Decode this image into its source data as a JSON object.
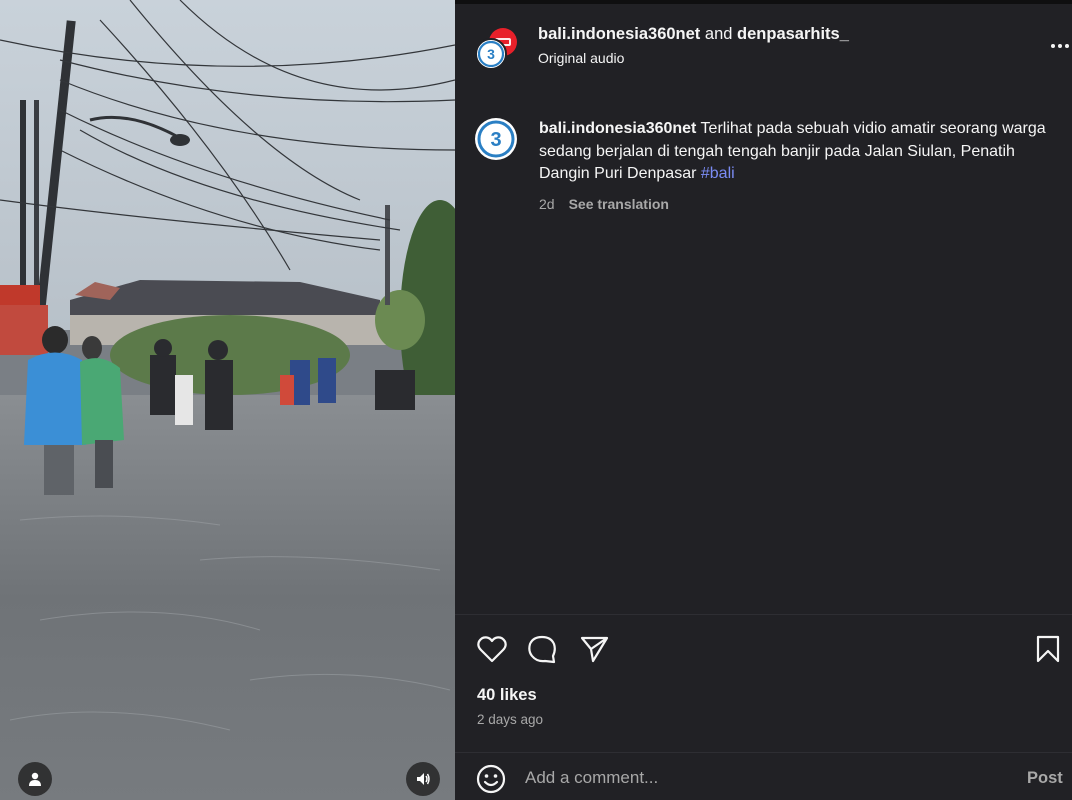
{
  "media": {
    "user_icon": "person-icon",
    "audio_icon": "speaker-icon"
  },
  "header": {
    "author": "bali.indonesia360net",
    "joiner": "and",
    "collaborator": "denpasarhits_",
    "audio_label": "Original audio",
    "avatar_glyph": "3°",
    "more_icon": "ellipsis-icon"
  },
  "caption": {
    "author": "bali.indonesia360net",
    "text": "Terlihat pada sebuah vidio amatir seorang warga sedang berjalan di tengah tengah banjir pada Jalan Siulan, Penatih Dangin Puri Denpasar",
    "hashtag": "#bali",
    "age": "2d",
    "translate_label": "See translation"
  },
  "actions": {
    "like_icon": "heart-icon",
    "comment_icon": "comment-bubble-icon",
    "share_icon": "paper-plane-icon",
    "save_icon": "bookmark-icon"
  },
  "stats": {
    "likes": "40 likes",
    "posted_ago": "2 days ago"
  },
  "comment": {
    "emoji_icon": "smiley-icon",
    "placeholder": "Add a comment...",
    "post_label": "Post"
  },
  "colors": {
    "panel_bg": "#212125",
    "text_primary": "#f5f5f5",
    "text_secondary": "#a8a8a8",
    "hashtag": "#7b8cf5",
    "avatar_blue": "#2a7fc4"
  }
}
